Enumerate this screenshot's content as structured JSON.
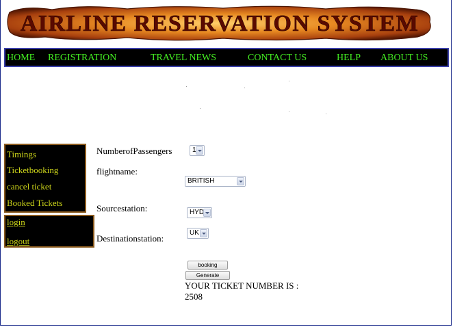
{
  "header": {
    "title": "AIRLINE RESERVATION SYSTEM"
  },
  "nav": {
    "home": "HOME",
    "registration": "REGISTRATION",
    "travel_news": "TRAVEL NEWS",
    "contact_us": "CONTACT US",
    "help": "HELP",
    "about_us": "ABOUT US"
  },
  "sidebar": {
    "menu": [
      "Timings",
      "Ticketbooking",
      "cancel ticket",
      "Booked Tickets"
    ],
    "account": [
      "login",
      "logout"
    ]
  },
  "form": {
    "passengers_label": "NumberofPassengers",
    "passengers_value": "1",
    "flight_label": "flightname:",
    "flight_value": "BRITISH",
    "source_label": "Sourcestation:",
    "source_value": "HYD",
    "destination_label": "Destinationstation:",
    "destination_value": "UK",
    "booking_button": "booking",
    "generate_button": "Generate",
    "ticket_label": "YOUR TICKET NUMBER IS :",
    "ticket_number": "2508"
  },
  "colors": {
    "banner_text": "#5a0a00",
    "banner_bg": "#e07a1a",
    "nav_bg": "#000000",
    "nav_text": "#44ee22",
    "sidebar_text": "#ccd41a",
    "sidebar_border": "#8a5a1e"
  }
}
